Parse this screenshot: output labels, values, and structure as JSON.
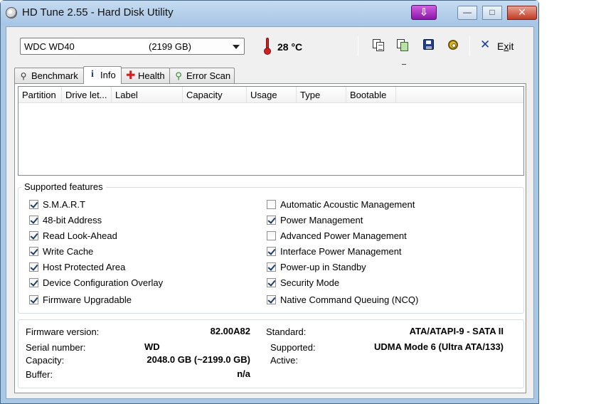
{
  "window": {
    "title": "HD Tune 2.55 - Hard Disk Utility",
    "minimize": "—",
    "maximize": "□",
    "close": "✕",
    "extra_button": "⇩"
  },
  "toolbar": {
    "drive_name": "WDC WD40",
    "drive_capacity": "(2199 GB)",
    "temperature": "28 °C",
    "exit_label_pre": "E",
    "exit_label_underlined": "x",
    "exit_label_post": "it",
    "icons": [
      "copy-text-icon",
      "copy-screenshot-icon",
      "save-icon",
      "options-icon",
      "exit-icon"
    ]
  },
  "tabs": [
    {
      "label": "Benchmark",
      "icon": "benchmark-icon"
    },
    {
      "label": "Info",
      "icon": "info-icon"
    },
    {
      "label": "Health",
      "icon": "health-icon"
    },
    {
      "label": "Error Scan",
      "icon": "error-scan-icon"
    }
  ],
  "partition_table": {
    "columns": [
      "Partition",
      "Drive let...",
      "Label",
      "Capacity",
      "Usage",
      "Type",
      "Bootable"
    ],
    "rows": []
  },
  "features": {
    "title": "Supported features",
    "left": [
      {
        "label": "S.M.A.R.T",
        "checked": true
      },
      {
        "label": "48-bit Address",
        "checked": true
      },
      {
        "label": "Read Look-Ahead",
        "checked": true
      },
      {
        "label": "Write Cache",
        "checked": true
      },
      {
        "label": "Host Protected Area",
        "checked": true
      },
      {
        "label": "Device Configuration Overlay",
        "checked": true
      },
      {
        "label": "Firmware Upgradable",
        "checked": true
      }
    ],
    "right": [
      {
        "label": "Automatic Acoustic Management",
        "checked": false
      },
      {
        "label": "Power Management",
        "checked": true
      },
      {
        "label": "Advanced Power Management",
        "checked": false
      },
      {
        "label": "Interface Power Management",
        "checked": true
      },
      {
        "label": "Power-up in Standby",
        "checked": true
      },
      {
        "label": "Security Mode",
        "checked": true
      },
      {
        "label": "Native Command Queuing (NCQ)",
        "checked": true
      }
    ]
  },
  "details": {
    "firmware_label": "Firmware version:",
    "firmware_value": "82.00A82",
    "serial_label": "Serial number:",
    "serial_value": "WD",
    "capacity_label": "Capacity:",
    "capacity_value": "2048.0 GB (~2199.0 GB)",
    "buffer_label": "Buffer:",
    "buffer_value": "n/a",
    "standard_label": "Standard:",
    "standard_value": "ATA/ATAPI-9 - SATA II",
    "supported_label": "Supported:",
    "supported_value": "UDMA Mode 6 (Ultra ATA/133)",
    "active_label": "Active:",
    "active_value": ""
  }
}
